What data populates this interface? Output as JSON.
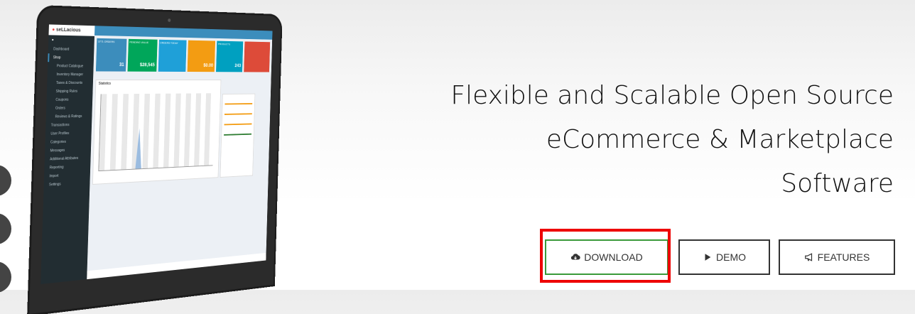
{
  "headline": {
    "line1": "Flexible and Scalable Open Source",
    "line2": "eCommerce & Marketplace",
    "line3": "Software"
  },
  "buttons": {
    "download": "DOWNLOAD",
    "demo": "DEMO",
    "features": "FEATURES"
  },
  "icons": {
    "download": "cloud-download-icon",
    "demo": "play-icon",
    "features": "megaphone-icon"
  },
  "colors": {
    "highlight": "#e00000",
    "download_border": "#3a9a3a"
  },
  "mockup": {
    "logo": "seLLacious",
    "nav": [
      "Dashboard",
      "Shop",
      "Product Catalogue",
      "Inventory Manager",
      "Taxes & Discounts",
      "Shipping Rules",
      "Coupons",
      "Orders",
      "Reviews & Ratings",
      "Transactions",
      "User Profiles",
      "Categories",
      "Messages",
      "Additional Attributes",
      "Reporting",
      "Import",
      "Settings"
    ],
    "tiles": [
      {
        "label": "3771 ORDERS",
        "value": "31",
        "color": "#3c8dbc"
      },
      {
        "label": "PENDING VALUE",
        "value": "$28,545",
        "color": "#00a65a"
      },
      {
        "label": "ORDERS TODAY",
        "value": "",
        "color": "#1fa0d8"
      },
      {
        "label": "",
        "value": "$0.00",
        "color": "#f39c12"
      },
      {
        "label": "PRODUCTS",
        "value": "243",
        "color": "#00a0c0"
      },
      {
        "label": "",
        "value": "",
        "color": "#dd4b39"
      }
    ],
    "chart_label": "Statistics"
  }
}
